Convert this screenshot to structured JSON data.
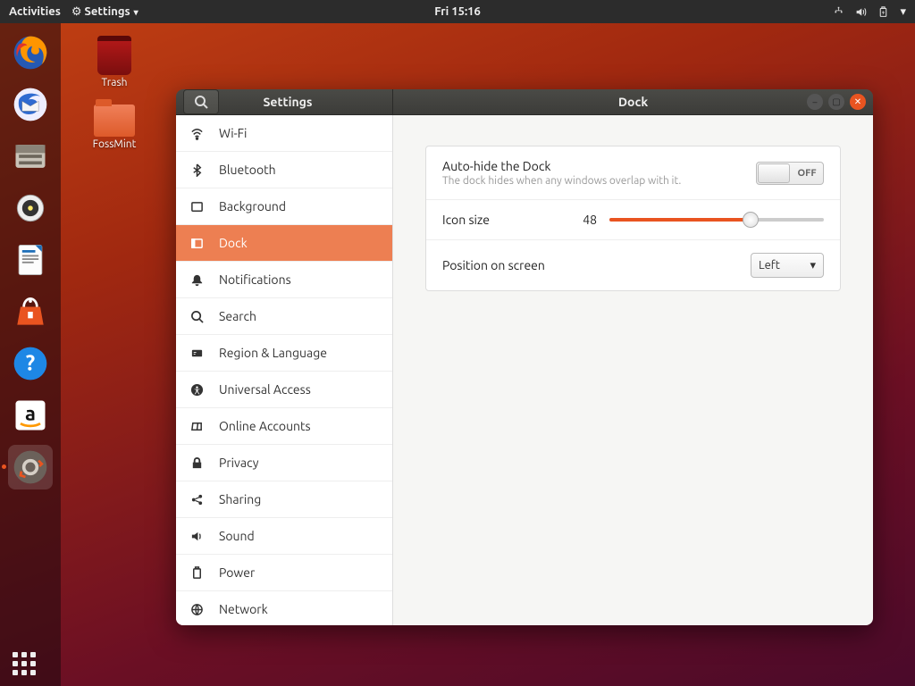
{
  "topbar": {
    "activities": "Activities",
    "app_menu": "Settings",
    "clock": "Fri 15:16"
  },
  "desktop": {
    "icons": [
      {
        "name": "trash",
        "label": "Trash"
      },
      {
        "name": "folder-fossmint",
        "label": "FossMint"
      }
    ]
  },
  "dock": {
    "items": [
      {
        "name": "firefox"
      },
      {
        "name": "thunderbird"
      },
      {
        "name": "files"
      },
      {
        "name": "rhythmbox"
      },
      {
        "name": "libreoffice-writer"
      },
      {
        "name": "ubuntu-software"
      },
      {
        "name": "help"
      },
      {
        "name": "amazon"
      },
      {
        "name": "settings"
      }
    ]
  },
  "window": {
    "app_title": "Settings",
    "page_title": "Dock",
    "sidebar": [
      {
        "icon": "wifi",
        "label": "Wi-Fi"
      },
      {
        "icon": "bluetooth",
        "label": "Bluetooth"
      },
      {
        "icon": "background",
        "label": "Background"
      },
      {
        "icon": "dock",
        "label": "Dock",
        "selected": true
      },
      {
        "icon": "bell",
        "label": "Notifications"
      },
      {
        "icon": "search",
        "label": "Search"
      },
      {
        "icon": "region",
        "label": "Region & Language"
      },
      {
        "icon": "accessibility",
        "label": "Universal Access"
      },
      {
        "icon": "accounts",
        "label": "Online Accounts"
      },
      {
        "icon": "privacy",
        "label": "Privacy"
      },
      {
        "icon": "sharing",
        "label": "Sharing"
      },
      {
        "icon": "sound",
        "label": "Sound"
      },
      {
        "icon": "power",
        "label": "Power"
      },
      {
        "icon": "network",
        "label": "Network"
      }
    ],
    "dock_settings": {
      "autohide": {
        "title": "Auto-hide the Dock",
        "sub": "The dock hides when any windows overlap with it.",
        "value": "OFF"
      },
      "icon_size": {
        "title": "Icon size",
        "value": "48"
      },
      "position": {
        "title": "Position on screen",
        "value": "Left"
      }
    }
  }
}
